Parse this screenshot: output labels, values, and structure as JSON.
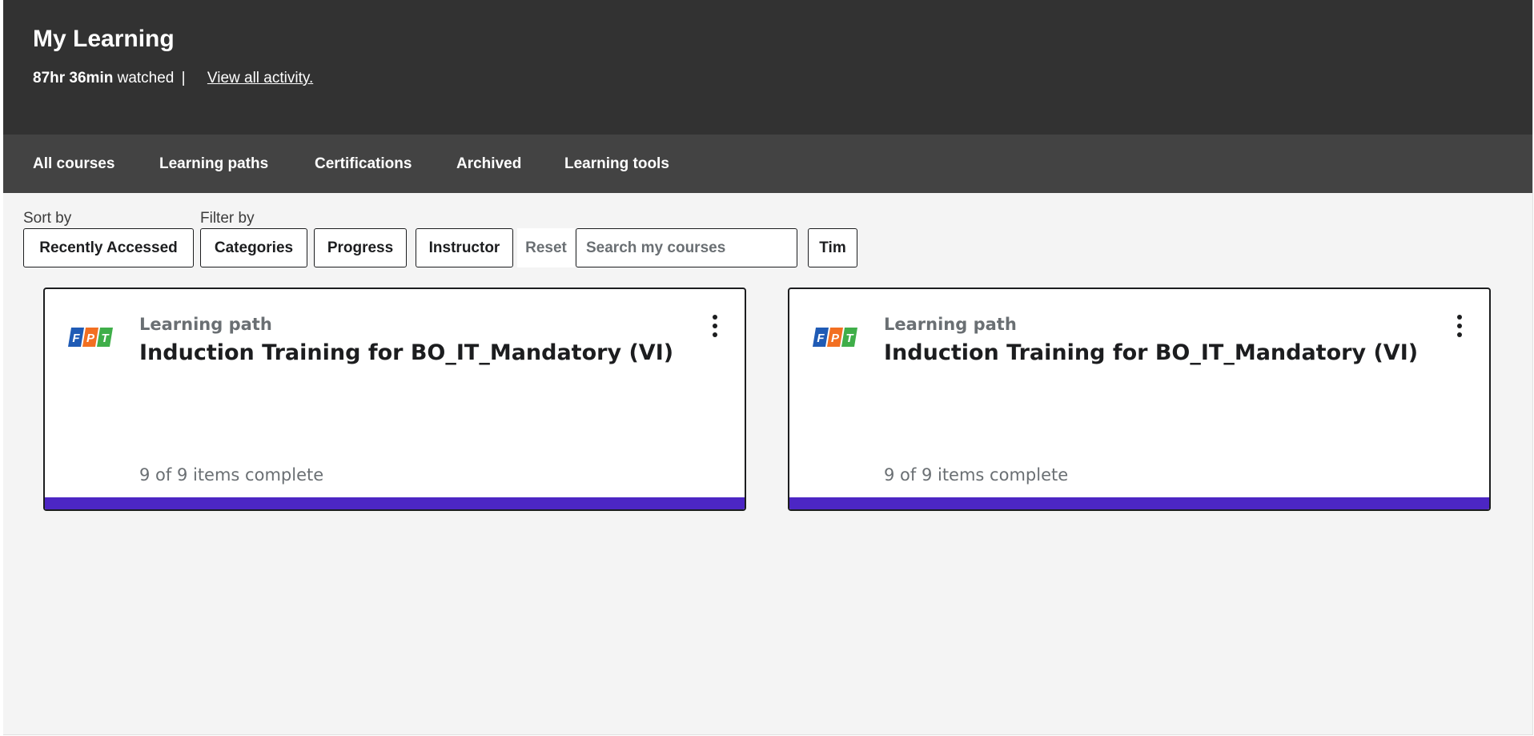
{
  "header": {
    "title": "My Learning",
    "watched_time": "87hr 36min",
    "watched_suffix": "watched",
    "separator": "|",
    "activity_link": "View all activity."
  },
  "tabs": [
    {
      "label": "All courses"
    },
    {
      "label": "Learning paths"
    },
    {
      "label": "Certifications"
    },
    {
      "label": "Archived"
    },
    {
      "label": "Learning tools"
    }
  ],
  "toolbar": {
    "sort_label": "Sort by",
    "sort_value": "Recently Accessed",
    "filter_label": "Filter by",
    "filters": [
      "Categories",
      "Progress",
      "Instructor"
    ],
    "reset_label": "Reset",
    "search_placeholder": "Search my courses",
    "search_button": "Tim"
  },
  "cards": [
    {
      "kind": "Learning path",
      "title": "Induction Training for BO_IT_Mandatory (VI)",
      "progress_text": "9 of 9 items complete",
      "progress": 1.0,
      "logo_text": "FPT"
    },
    {
      "kind": "Learning path",
      "title": "Induction Training for BO_IT_Mandatory (VI)",
      "progress_text": "9 of 9 items complete",
      "progress": 1.0,
      "logo_text": "FPT"
    }
  ],
  "colors": {
    "header_bg": "#323232",
    "tabs_bg": "#434343",
    "progress_fill": "#4c26c4",
    "logo_blue": "#1f5bb5",
    "logo_orange": "#f26f21",
    "logo_green": "#3fae49"
  }
}
